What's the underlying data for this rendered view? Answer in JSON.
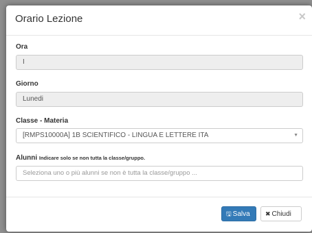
{
  "modal": {
    "title": "Orario Lezione",
    "close_icon": "×"
  },
  "fields": {
    "ora": {
      "label": "Ora",
      "value": "I"
    },
    "giorno": {
      "label": "Giorno",
      "value": "Lunedi"
    },
    "classe": {
      "label": "Classe - Materia",
      "value": "[RMPS10000A] 1B SCIENTIFICO - LINGUA E LETTERE ITA"
    },
    "alunni": {
      "label": "Alunni",
      "hint": "Indicare solo se non tutta la classe/gruppo.",
      "placeholder": "Seleziona uno o più alunni se non è tutta la classe/gruppo ..."
    }
  },
  "footer": {
    "save_label": "Salva",
    "close_label": "Chiudi"
  },
  "colors": {
    "primary": "#337ab7",
    "readonly_bg": "#eeeeee"
  }
}
